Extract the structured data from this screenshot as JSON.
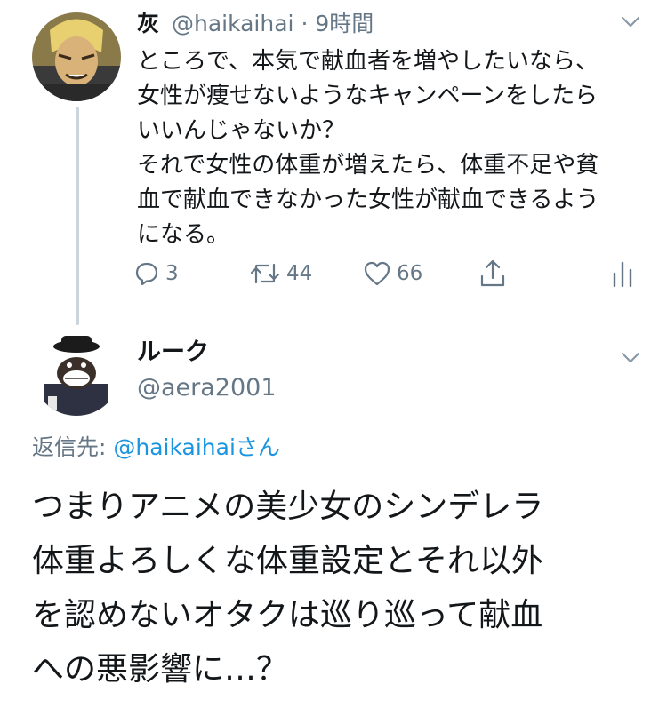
{
  "tweet1": {
    "author_name": "灰",
    "handle": "@haikaihai",
    "separator": "·",
    "time": "9時間",
    "body_lines": [
      "ところで、本気で献血者を増やしたいなら、",
      "女性が痩せないようなキャンペーンをしたら",
      "いいんじゃないか？",
      "それで女性の体重が増えたら、体重不足や貧",
      "血で献血できなかった女性が献血できるよう",
      "になる。"
    ],
    "actions": {
      "reply_icon": "reply-icon",
      "reply_count": "3",
      "retweet_icon": "retweet-icon",
      "retweet_count": "44",
      "like_icon": "heart-icon",
      "like_count": "66",
      "share_icon": "share-icon",
      "stats_icon": "analytics-icon"
    }
  },
  "tweet2": {
    "author_name": "ルーク",
    "handle": "@aera2001",
    "reply_prefix": "返信先: ",
    "reply_mention": "@haikaihai",
    "reply_suffix": "さん",
    "body_lines": [
      "つまりアニメの美少女のシンデレラ",
      "体重よろしくな体重設定とそれ以外",
      "を認めないオタクは巡り巡って献血",
      "への悪影響に…？"
    ]
  },
  "colors": {
    "text_primary": "#14171a",
    "text_secondary": "#657786",
    "link": "#1b95e0",
    "thread_line": "#cdd5dc"
  }
}
